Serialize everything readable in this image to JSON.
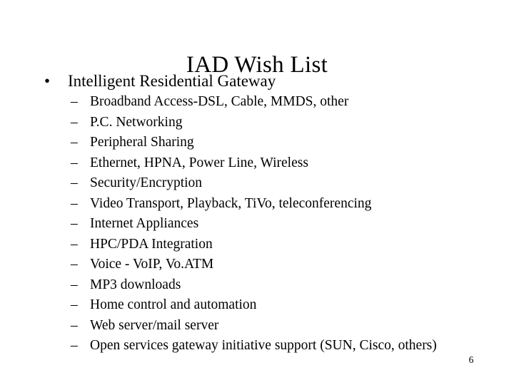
{
  "slide": {
    "title": "IAD Wish List",
    "background_color": "#ffffff",
    "text_color": "#000000",
    "page_number": "6",
    "level1_bullet_glyph": "•",
    "level2_bullet_glyph": "–",
    "bullets": [
      {
        "label": "Intelligent Residential Gateway",
        "sub_items": [
          "Broadband Access-DSL, Cable, MMDS, other",
          "P.C. Networking",
          "Peripheral Sharing",
          "Ethernet, HPNA, Power Line, Wireless",
          "Security/Encryption",
          "Video Transport, Playback, TiVo, teleconferencing",
          "Internet Appliances",
          "HPC/PDA Integration",
          "Voice - VoIP, Vo.ATM",
          "MP3 downloads",
          "Home control and automation",
          "Web server/mail server",
          "Open services gateway initiative support (SUN, Cisco, others)"
        ]
      }
    ]
  }
}
